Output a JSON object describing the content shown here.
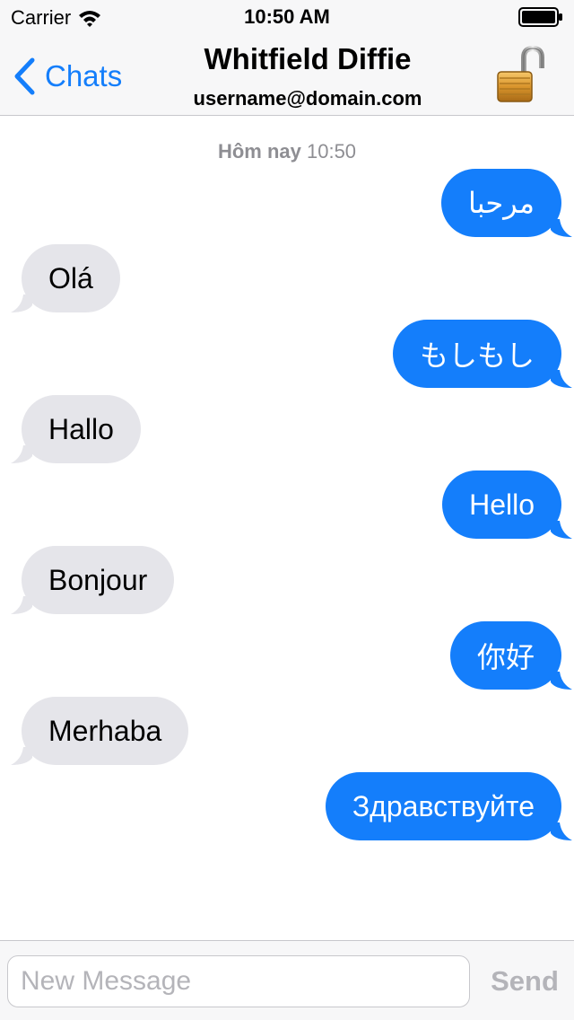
{
  "status_bar": {
    "carrier": "Carrier",
    "time": "10:50 AM"
  },
  "nav": {
    "back_label": "Chats",
    "title": "Whitfield Diffie",
    "subtitle": "username@domain.com",
    "accent_color": "#147efb"
  },
  "conversation": {
    "timestamp_day": "Hôm nay",
    "timestamp_time": "10:50",
    "messages": [
      {
        "direction": "outgoing",
        "text": "مرحبا"
      },
      {
        "direction": "incoming",
        "text": "Olá"
      },
      {
        "direction": "outgoing",
        "text": "もしもし"
      },
      {
        "direction": "incoming",
        "text": "Hallo"
      },
      {
        "direction": "outgoing",
        "text": "Hello"
      },
      {
        "direction": "incoming",
        "text": "Bonjour"
      },
      {
        "direction": "outgoing",
        "text": "你好"
      },
      {
        "direction": "incoming",
        "text": "Merhaba"
      },
      {
        "direction": "outgoing",
        "text": "Здравствуйте"
      }
    ],
    "incoming_color": "#e5e5ea",
    "outgoing_color": "#147efb"
  },
  "composer": {
    "placeholder": "New Message",
    "value": "",
    "send_label": "Send"
  },
  "icons": {
    "wifi": "wifi-icon",
    "battery": "battery-icon",
    "back": "chevron-left-icon",
    "lock": "unlocked-padlock-icon"
  }
}
